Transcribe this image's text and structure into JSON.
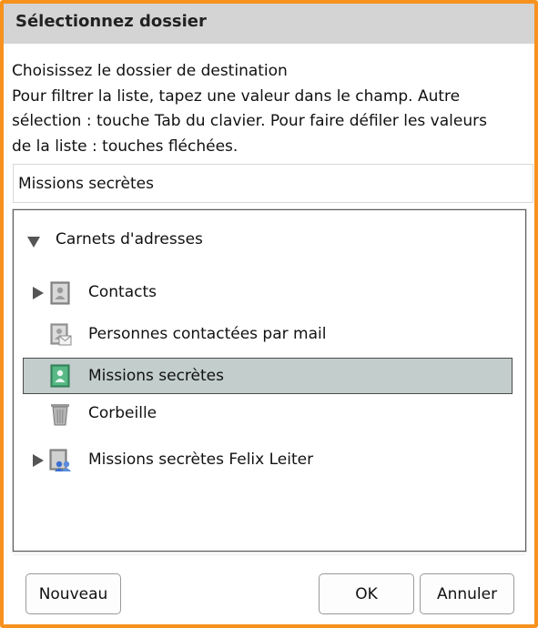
{
  "dialog": {
    "title": "Sélectionnez dossier",
    "instructions": [
      "Choisissez le dossier de destination",
      "Pour filtrer la liste, tapez une valeur dans le champ. Autre",
      "sélection : touche Tab du clavier. Pour faire défiler les valeurs",
      "de la liste : touches fléchées."
    ]
  },
  "filter": {
    "value": "Missions secrètes"
  },
  "tree": {
    "root": {
      "label": "Carnets d'adresses",
      "expanded": true
    },
    "items": [
      {
        "label": "Contacts",
        "icon": "address-book-icon",
        "has_children": true,
        "selected": false
      },
      {
        "label": "Personnes contactées par mail",
        "icon": "collected-addresses-icon",
        "has_children": false,
        "selected": false
      },
      {
        "label": "Missions secrètes",
        "icon": "address-book-green-icon",
        "has_children": false,
        "selected": true
      },
      {
        "label": "Corbeille",
        "icon": "trash-icon",
        "has_children": false,
        "selected": false
      },
      {
        "label": "Missions secrètes Felix Leiter",
        "icon": "shared-address-book-icon",
        "has_children": true,
        "selected": false
      }
    ]
  },
  "buttons": {
    "new": "Nouveau",
    "ok": "OK",
    "cancel": "Annuler"
  },
  "colors": {
    "frame": "#f7921e",
    "titlebar": "#d4d4d4",
    "selection": "#c2cdcc"
  }
}
